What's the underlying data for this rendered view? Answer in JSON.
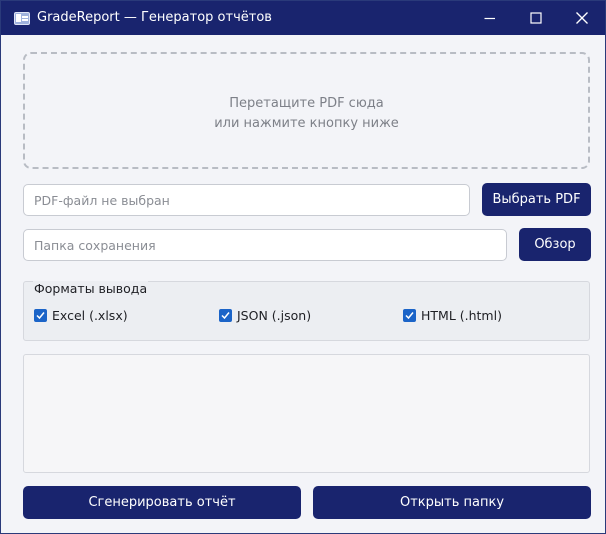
{
  "window": {
    "title": "GradeReport — Генератор отчётов",
    "icon": "app-window-icon",
    "controls": [
      "minimize-icon",
      "maximize-icon",
      "close-icon"
    ]
  },
  "drop_zone": {
    "line1": "Перетащите PDF сюда",
    "line2": "или нажмите кнопку ниже"
  },
  "pdf_field": {
    "value": "",
    "placeholder": "PDF-файл не выбран",
    "button_label": "Выбрать PDF"
  },
  "folder_field": {
    "value": "",
    "placeholder": "Папка сохранения",
    "button_label": "Обзор"
  },
  "formats": {
    "title": "Форматы вывода",
    "options": [
      {
        "label": "Excel (.xlsx)",
        "checked": true
      },
      {
        "label": "JSON (.json)",
        "checked": true
      },
      {
        "label": "HTML (.html)",
        "checked": true
      }
    ]
  },
  "log": {
    "text": ""
  },
  "actions": {
    "generate_label": "Сгенерировать отчёт",
    "open_folder_label": "Открыть папку"
  },
  "colors": {
    "accent": "#19246e",
    "checkbox": "#1b64c8",
    "background": "#f3f4f8"
  }
}
